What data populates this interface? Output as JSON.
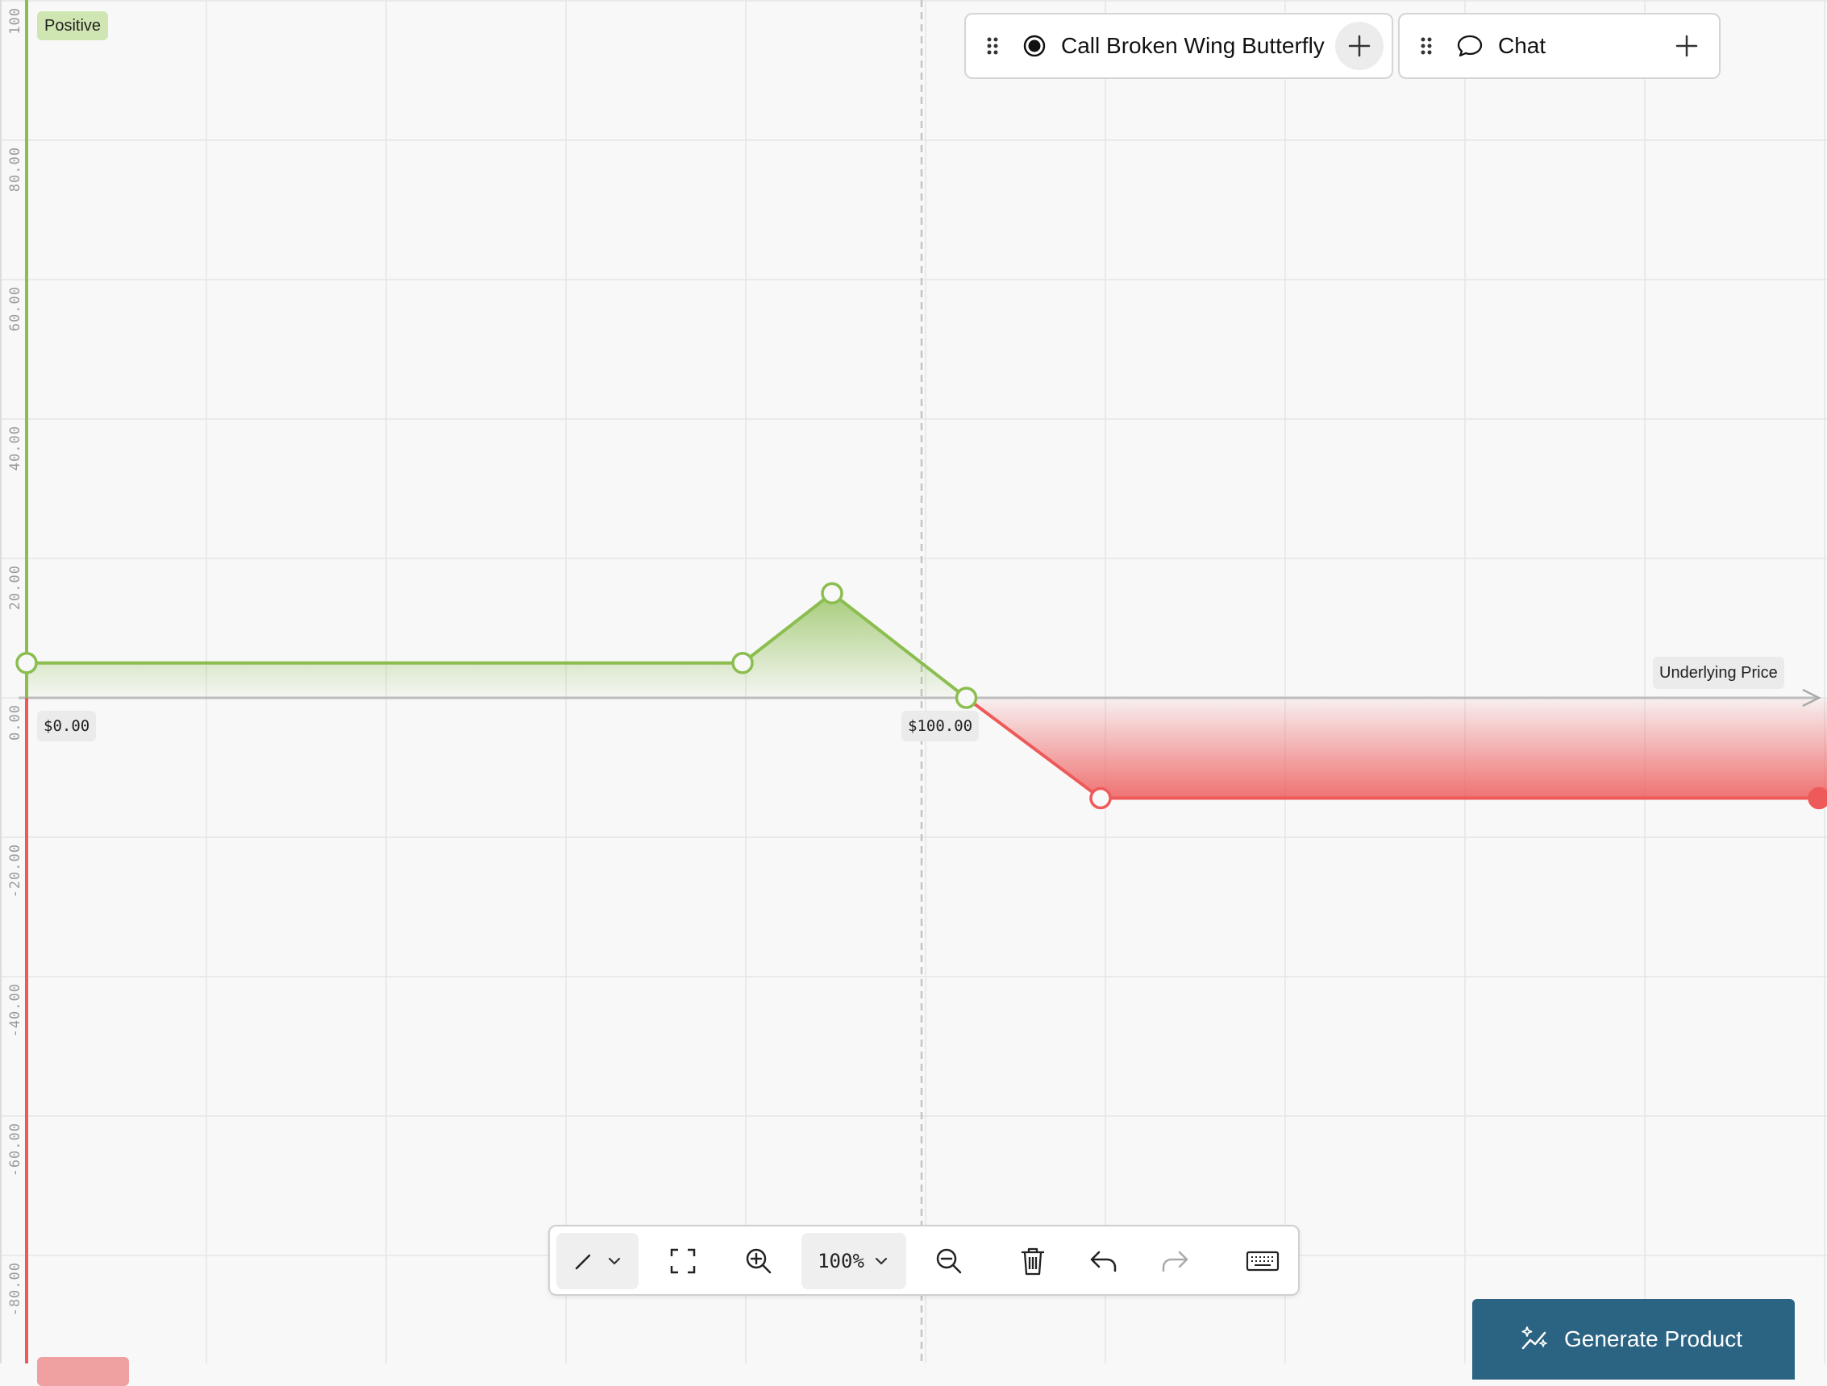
{
  "chart_data": {
    "type": "line",
    "xlabel": "Underlying Price",
    "ylabel": "",
    "xlim": [
      0,
      250
    ],
    "ylim": [
      -95,
      100
    ],
    "y_ticks": [
      "100",
      "80.00",
      "60.00",
      "40.00",
      "20.00",
      "0.00",
      "-20.00",
      "-40.00",
      "-60.00",
      "-80.00"
    ],
    "x_labels": [
      "$0.00",
      "$100.00"
    ],
    "grid": true,
    "series": [
      {
        "x": [
          0,
          80,
          90,
          105,
          120,
          250
        ],
        "y": [
          5,
          5,
          15,
          0,
          -14.4,
          -14.4
        ],
        "positive_color": "#8bbd4f",
        "negative_color": "#ee5a5a"
      }
    ],
    "vertical_marker_x": 100,
    "positive_label": "Positive"
  },
  "cards": {
    "strategy": {
      "title": "Call Broken Wing Butterfly",
      "icon": "radio-selected-icon"
    },
    "chat": {
      "title": "Chat",
      "icon": "chat-bubble-icon"
    }
  },
  "toolbar": {
    "zoom_label": "100%",
    "tools": [
      "pen-icon",
      "fit-screen-icon",
      "zoom-in-icon",
      "zoom-out-icon",
      "trash-icon",
      "undo-icon",
      "redo-icon",
      "keyboard-icon"
    ]
  },
  "generate": {
    "label": "Generate Product"
  },
  "colors": {
    "positive": "#8bbd4f",
    "negative": "#ee5a5a",
    "primary_button": "#2b6382",
    "grid": "#e6e6e6"
  }
}
